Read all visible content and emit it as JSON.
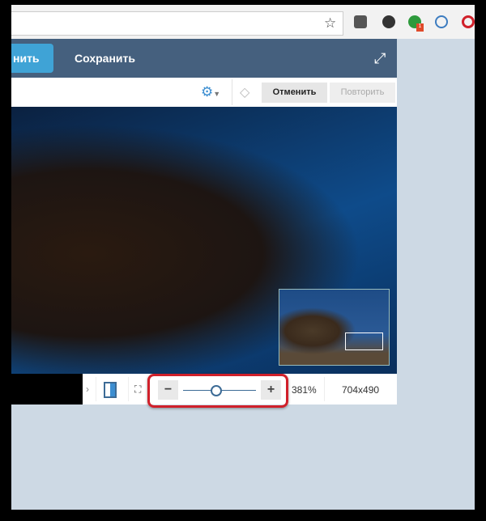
{
  "browser": {
    "bookmark_icon": "star-icon",
    "extensions": [
      {
        "name": "pocket-icon",
        "color": "#555"
      },
      {
        "name": "evernote-icon",
        "color": "#333"
      },
      {
        "name": "green-extension-icon",
        "color": "#2e9a3c",
        "badge": "1"
      },
      {
        "name": "drop-icon",
        "color": "#3c7cc0"
      },
      {
        "name": "opera-icon",
        "color": "#d0202a"
      }
    ]
  },
  "header": {
    "apply_label": "нить",
    "save_label": "Сохранить"
  },
  "toolbar": {
    "undo_label": "Отменить",
    "redo_label": "Повторить"
  },
  "statusbar": {
    "zoom": "381%",
    "dimensions": "704x490",
    "slider_value_fraction": 0.45
  },
  "colors": {
    "header": "#45607e",
    "accent": "#3fa3d6",
    "highlight": "#d0202a"
  }
}
